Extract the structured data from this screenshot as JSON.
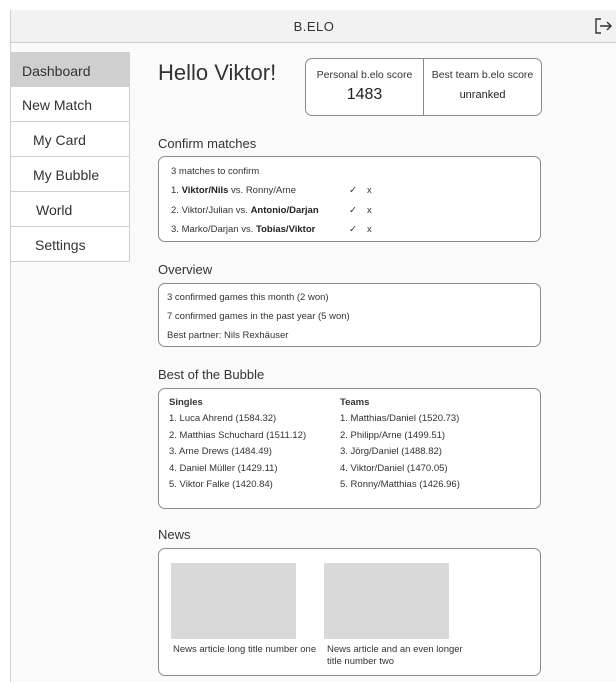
{
  "app": {
    "title": "B.ELO",
    "logout_icon": "logout-icon"
  },
  "sidebar": {
    "items": [
      {
        "label": "Dashboard",
        "active": true
      },
      {
        "label": "New Match"
      },
      {
        "label": "My Card"
      },
      {
        "label": "My Bubble"
      },
      {
        "label": "World"
      },
      {
        "label": "Settings"
      }
    ]
  },
  "greeting": "Hello Viktor!",
  "scores": {
    "personal": {
      "label": "Personal b.elo score",
      "value": "1483"
    },
    "team": {
      "label": "Best team b.elo score",
      "value": "unranked"
    }
  },
  "confirm": {
    "title": "Confirm matches",
    "summary": "3 matches to confirm",
    "matches": [
      {
        "prefix": "1. ",
        "bold_a": "Viktor/Nils",
        "mid": " vs. ",
        "plain_b": "Ronny/Arne",
        "bold_b": ""
      },
      {
        "prefix": "2. ",
        "bold_a": "",
        "plain_a": "Viktor/Julian",
        "mid": " vs. ",
        "bold_b": "Antonio/Darjan"
      },
      {
        "prefix": "3. ",
        "bold_a": "",
        "plain_a": "Marko/Darjan",
        "mid": " vs. ",
        "bold_b": "Tobias/Viktor"
      }
    ],
    "confirm_symbol": "✓",
    "reject_symbol": "x"
  },
  "overview": {
    "title": "Overview",
    "lines": [
      "3 confirmed games this month (2 won)",
      "7 confirmed games in the past year (5 won)",
      "Best partner: Nils Rexhäuser"
    ]
  },
  "bubble": {
    "title": "Best of the Bubble",
    "singles": {
      "header": "Singles",
      "rows": [
        "1. Luca Ahrend (1584.32)",
        "2. Matthias Schuchard (1511.12)",
        "3. Arne Drews (1484.49)",
        "4. Daniel Müller (1429.11)",
        "5. Viktor Falke (1420.84)"
      ]
    },
    "teams": {
      "header": "Teams",
      "rows": [
        "1. Matthias/Daniel (1520.73)",
        "2. Philipp/Arne (1499.51)",
        "3. Jörg/Daniel (1488.82)",
        "4. Viktor/Daniel (1470.05)",
        "5. Ronny/Matthias (1426.96)"
      ]
    }
  },
  "news": {
    "title": "News",
    "articles": [
      {
        "title": "News article long title number one"
      },
      {
        "title": "News article and an even longer title number two"
      }
    ]
  }
}
